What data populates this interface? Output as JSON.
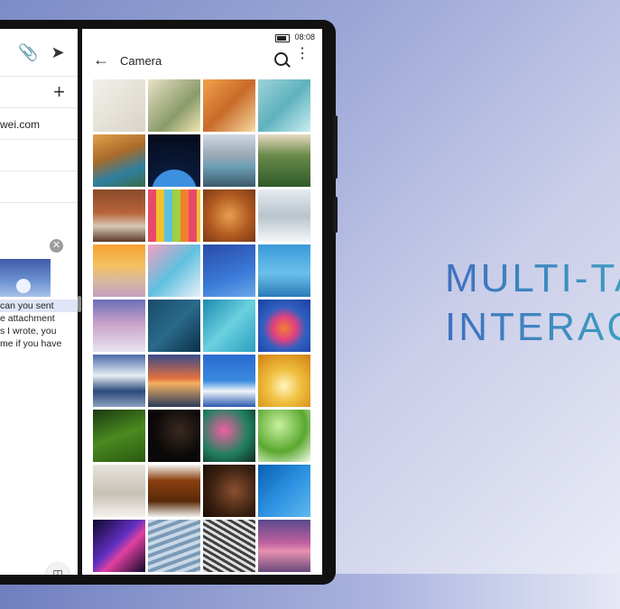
{
  "headline": {
    "line1": "MULTI-TA",
    "line2": "INTERAC"
  },
  "status_bar": {
    "time": "08:08"
  },
  "mail_pane": {
    "recipient_fragment": "wei.com",
    "body_lines": [
      "can you sent",
      "e attachment",
      "s I wrote, you",
      "me if you have"
    ]
  },
  "gallery_pane": {
    "title": "Camera",
    "back_icon": "arrow-left-icon",
    "search_icon": "search-icon",
    "more_icon": "more-vertical-icon",
    "thumbnails": [
      {
        "name": "white-flowers"
      },
      {
        "name": "lemon-drink"
      },
      {
        "name": "teacup"
      },
      {
        "name": "water-ripples"
      },
      {
        "name": "river-forest"
      },
      {
        "name": "earth-space"
      },
      {
        "name": "mountain-lake"
      },
      {
        "name": "pine-forest"
      },
      {
        "name": "wooden-house"
      },
      {
        "name": "macarons"
      },
      {
        "name": "croissant"
      },
      {
        "name": "snowy-trees"
      },
      {
        "name": "golden-field"
      },
      {
        "name": "colorful-ice"
      },
      {
        "name": "blue-abstract"
      },
      {
        "name": "ocean-horizon"
      },
      {
        "name": "snowfield-sunset"
      },
      {
        "name": "boat-wake"
      },
      {
        "name": "teal-wave"
      },
      {
        "name": "paint-splash"
      },
      {
        "name": "snow-mountain-reflection"
      },
      {
        "name": "sunset-lake"
      },
      {
        "name": "island-coast"
      },
      {
        "name": "flower-macro"
      },
      {
        "name": "green-field"
      },
      {
        "name": "silhouette-dancer"
      },
      {
        "name": "pink-flowers"
      },
      {
        "name": "green-leaves"
      },
      {
        "name": "white-sofa"
      },
      {
        "name": "violin"
      },
      {
        "name": "cello-scroll"
      },
      {
        "name": "blue-gradient"
      },
      {
        "name": "purple-waves"
      },
      {
        "name": "silver-ripples"
      },
      {
        "name": "metal-lines"
      },
      {
        "name": "pier-sunset"
      }
    ]
  },
  "colors": {
    "accent": "#3f6fc0",
    "headline_end": "#3da2c0"
  }
}
